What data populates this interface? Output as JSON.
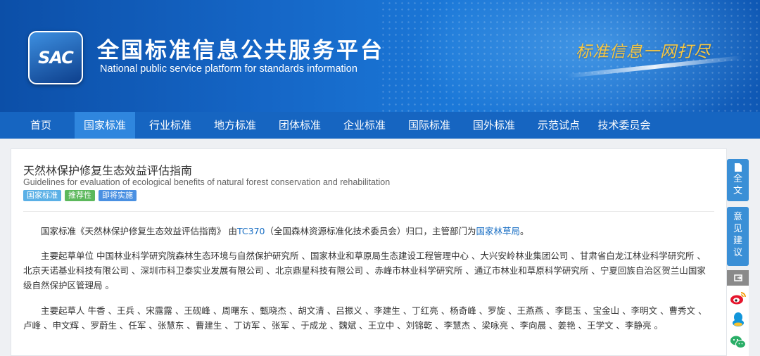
{
  "header": {
    "logo_text": "SAC",
    "title": "全国标准信息公共服务平台",
    "subtitle": "National public service platform  for standards information",
    "slogan": "标准信息一网打尽"
  },
  "nav": {
    "items": [
      {
        "label": "首页"
      },
      {
        "label": "国家标准"
      },
      {
        "label": "行业标准"
      },
      {
        "label": "地方标准"
      },
      {
        "label": "团体标准"
      },
      {
        "label": "企业标准"
      },
      {
        "label": "国际标准"
      },
      {
        "label": "国外标准"
      },
      {
        "label": "示范试点"
      },
      {
        "label": "技术委员会"
      }
    ],
    "active_index": 1
  },
  "standard": {
    "title": "天然林保护修复生态效益评估指南",
    "title_en": "Guidelines for evaluation of ecological benefits of natural forest conservation and rehabilitation",
    "tags": [
      {
        "label": "国家标准",
        "color": "#5bb0e6"
      },
      {
        "label": "推荐性",
        "color": "#5cb85c"
      },
      {
        "label": "即将实施",
        "color": "#4a90e2"
      }
    ],
    "intro": {
      "prefix": "国家标准《天然林保护修复生态效益评估指南》 由",
      "tc_link": "TC370",
      "middle": "（全国森林资源标准化技术委员会）归口，主管部门为",
      "dept_link": "国家林草局",
      "suffix": "。"
    },
    "drafting_units": "主要起草单位 中国林业科学研究院森林生态环境与自然保护研究所 、国家林业和草原局生态建设工程管理中心 、大兴安岭林业集团公司 、甘肃省白龙江林业科学研究所 、北京天诺基业科技有限公司 、深圳市科卫泰实业发展有限公司 、北京鼎星科技有限公司 、赤峰市林业科学研究所 、通辽市林业和草原科学研究所 、宁夏回族自治区贺兰山国家级自然保护区管理局 。",
    "drafters": "主要起草人 牛香 、王兵 、宋露露 、王砚峰 、周曙东 、甄晓杰 、胡文清 、吕振义 、李建生 、丁红亮 、杨奇峰 、罗旋 、王燕燕 、李昆玉 、宝金山 、李明文 、曹秀文 、卢峰 、申文辉 、罗蔚生 、任军 、张慧东 、曹建生 、丁访军 、张军 、于成龙 、魏斌 、王立中 、刘锦乾 、李慧杰 、梁咏亮 、李向晨 、姜艳 、王学文 、李静亮 。"
  },
  "sidebar": {
    "fulltext": [
      "全",
      "文"
    ],
    "feedback": [
      "意",
      "见",
      "建",
      "议"
    ]
  },
  "colors": {
    "banner": "#1566c6",
    "nav": "#1665c1",
    "nav_active": "#2f86de",
    "link": "#1a6fc4",
    "side_button": "#3a8fd6"
  }
}
